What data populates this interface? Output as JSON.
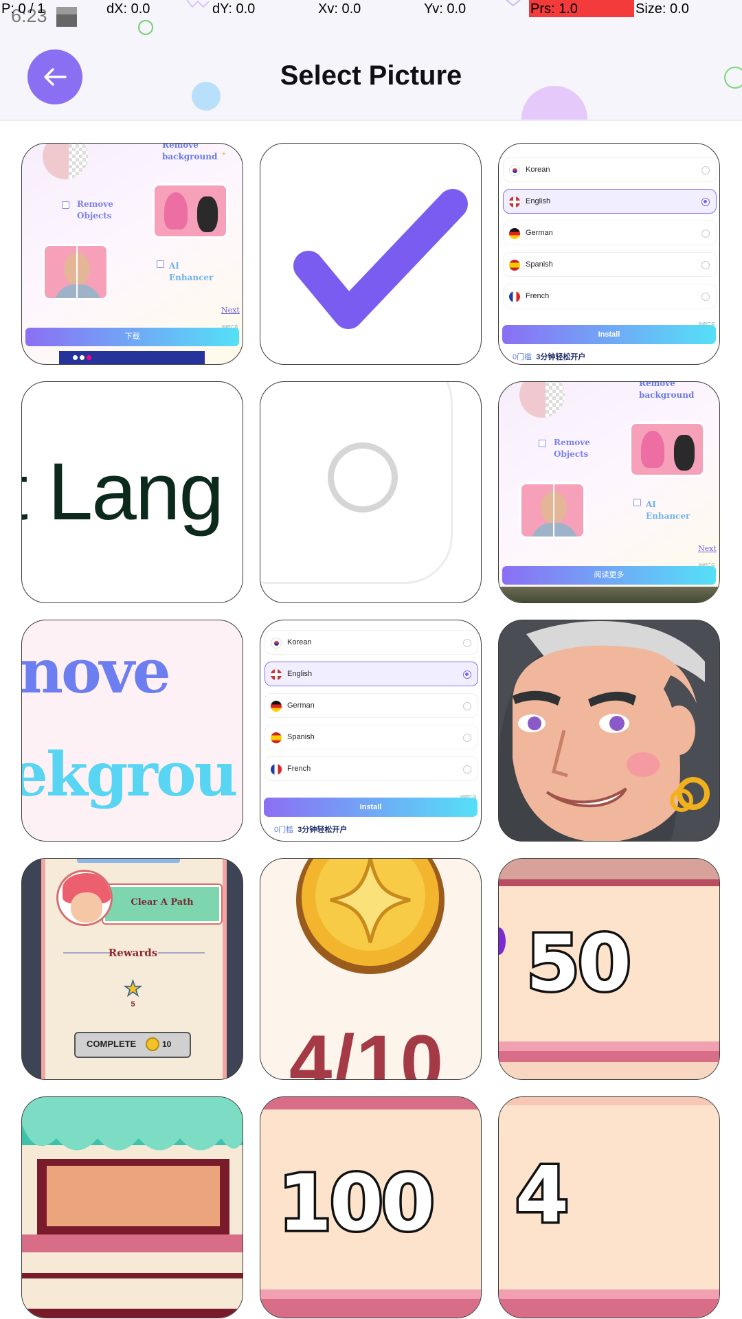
{
  "debug_overlay": {
    "pointer": "P: 0 / 1",
    "dx": "dX: 0.0",
    "dy": "dY: 0.0",
    "xv": "Xv: 0.0",
    "yv": "Yv: 0.0",
    "pressure": "Prs: 1.0",
    "size": "Size: 0.0"
  },
  "status_bar": {
    "time": "6:23"
  },
  "header": {
    "title": "Select Picture",
    "back_icon": "arrow-left-icon",
    "accent_color": "#8b6ff2"
  },
  "tiles": {
    "promo": {
      "remove_background": "Remove\nbackground",
      "remove_objects": "Remove\nObjects",
      "ai_enhancer": "AI\nEnhancer",
      "next": "Next",
      "ad_tag": "贴吧广告"
    },
    "t1": {
      "button": "下载"
    },
    "t2": {
      "icon": "checkmark-icon"
    },
    "t3": {
      "languages": [
        "Korean",
        "English",
        "German",
        "Spanish",
        "French"
      ],
      "selected": "English",
      "install": "Install",
      "footer_prefix": "0门槛",
      "footer_text": "3分钟轻松开户"
    },
    "t4": {
      "text": "t Lang"
    },
    "t5": {
      "icon": "radio-unselected-icon"
    },
    "t6": {
      "button": "阅读更多"
    },
    "t7": {
      "line1": "nove",
      "line2": "ekgrou"
    },
    "t8": {
      "languages": [
        "Korean",
        "English",
        "German",
        "Spanish",
        "French"
      ],
      "install": "Install",
      "footer_prefix": "0门槛",
      "footer_text": "3分钟轻松开户"
    },
    "t9": {
      "icon": "character-portrait"
    },
    "t10": {
      "quest": "Clear A Path",
      "rewards": "Rewards",
      "star_count": "5",
      "complete": "COMPLETE",
      "coin_count": "10"
    },
    "t11": {
      "fraction": "4/10"
    },
    "t12": {
      "value": "50"
    },
    "t13": {
      "icon": "shop-awning"
    },
    "t14": {
      "value": "100"
    },
    "t15": {
      "value": "4"
    }
  }
}
